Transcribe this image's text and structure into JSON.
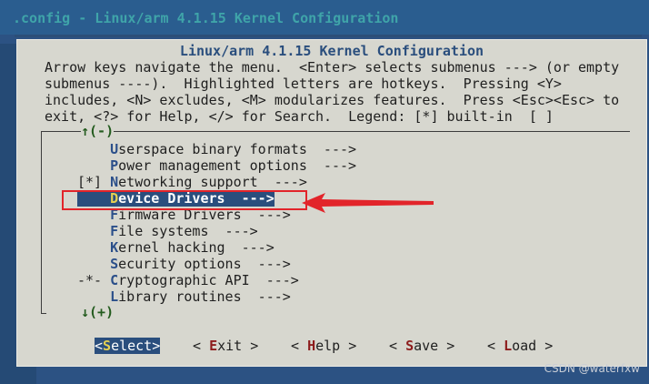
{
  "window": {
    "top_title": ".config - Linux/arm 4.1.15 Kernel Configuration"
  },
  "dialog": {
    "title": "Linux/arm 4.1.15 Kernel Configuration",
    "help_lines": [
      "Arrow keys navigate the menu.  <Enter> selects submenus ---> (or empty",
      "submenus ----).  Highlighted letters are hotkeys.  Pressing <Y>",
      "includes, <N> excludes, <M> modularizes features.  Press <Esc><Esc> to",
      "exit, <?> for Help, </> for Search.  Legend: [*] built-in  [ ]"
    ]
  },
  "scroll": {
    "up": "↑(-)",
    "down": "↓(+)"
  },
  "menu": {
    "items": [
      {
        "prefix": "    ",
        "hotkey": "U",
        "rest": "serspace binary formats  --->"
      },
      {
        "prefix": "    ",
        "hotkey": "P",
        "rest": "ower management options  --->"
      },
      {
        "prefix": "[*] ",
        "hotkey": "N",
        "rest": "etworking support  --->"
      },
      {
        "prefix": "    ",
        "hotkey": "D",
        "rest": "evice Drivers  --->",
        "selected": true
      },
      {
        "prefix": "    ",
        "hotkey": "F",
        "rest": "irmware Drivers  --->"
      },
      {
        "prefix": "    ",
        "hotkey": "F",
        "rest": "ile systems  --->"
      },
      {
        "prefix": "    ",
        "hotkey": "K",
        "rest": "ernel hacking  --->"
      },
      {
        "prefix": "    ",
        "hotkey": "S",
        "rest": "ecurity options  --->"
      },
      {
        "prefix": "-*- ",
        "hotkey": "C",
        "rest": "ryptographic API  --->"
      },
      {
        "prefix": "    ",
        "hotkey": "L",
        "rest": "ibrary routines  --->"
      }
    ]
  },
  "buttons": {
    "select": {
      "before": "<",
      "hotkey": "S",
      "after": "elect>"
    },
    "exit": {
      "before": "< ",
      "hotkey": "E",
      "after": "xit >"
    },
    "help": {
      "before": "< ",
      "hotkey": "H",
      "after": "elp >"
    },
    "save": {
      "before": "< ",
      "hotkey": "S",
      "after": "ave >"
    },
    "load": {
      "before": "< ",
      "hotkey": "L",
      "after": "oad >"
    }
  },
  "watermark": "CSDN @waterfxw",
  "colors": {
    "background": "#2c5283",
    "dialog": "#d7d7cf",
    "highlight": "#2a4e7d",
    "annotation": "#e2242a"
  }
}
